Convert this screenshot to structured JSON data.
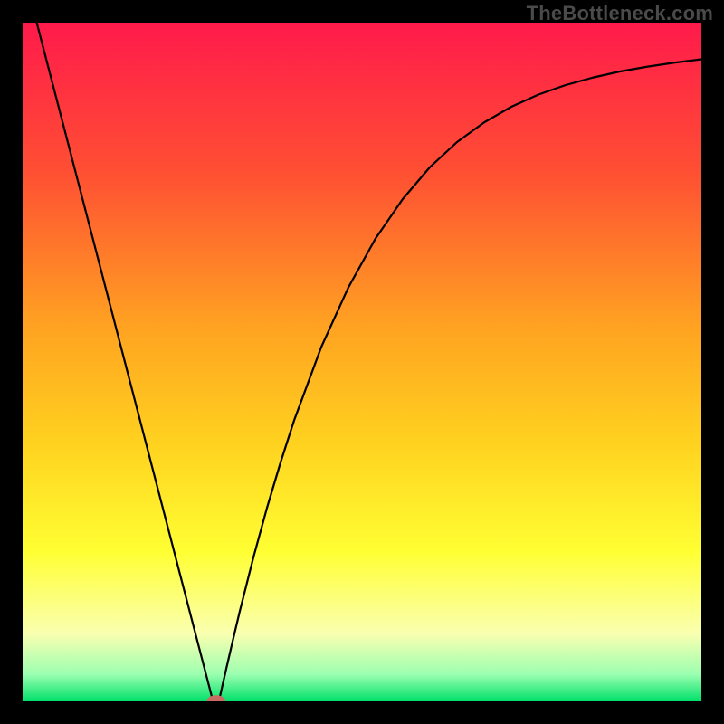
{
  "watermark": "TheBottleneck.com",
  "chart_data": {
    "type": "line",
    "title": "",
    "xlabel": "",
    "ylabel": "",
    "xlim": [
      0,
      100
    ],
    "ylim": [
      0,
      100
    ],
    "background_gradient": {
      "stops": [
        {
          "offset": 0.0,
          "color": "#ff1a4b"
        },
        {
          "offset": 0.22,
          "color": "#ff4f33"
        },
        {
          "offset": 0.45,
          "color": "#ffa321"
        },
        {
          "offset": 0.62,
          "color": "#ffd21f"
        },
        {
          "offset": 0.78,
          "color": "#ffff33"
        },
        {
          "offset": 0.9,
          "color": "#faffb0"
        },
        {
          "offset": 0.96,
          "color": "#9cffb0"
        },
        {
          "offset": 1.0,
          "color": "#00e06a"
        }
      ]
    },
    "series": [
      {
        "name": "bottleneck-curve",
        "x": [
          0,
          2,
          4,
          6,
          8,
          10,
          12,
          14,
          16,
          18,
          20,
          22,
          24,
          26,
          27,
          28,
          28.5,
          29,
          30,
          31,
          32,
          34,
          36,
          38,
          40,
          44,
          48,
          52,
          56,
          60,
          64,
          68,
          72,
          76,
          80,
          84,
          88,
          92,
          96,
          100
        ],
        "y": [
          108,
          100.3,
          92.6,
          84.9,
          77.2,
          69.5,
          61.8,
          54.1,
          46.4,
          38.7,
          31.0,
          23.3,
          15.6,
          7.9,
          4.05,
          0.2,
          0.0,
          0.4,
          4.8,
          9.1,
          13.3,
          21.2,
          28.5,
          35.2,
          41.4,
          52.2,
          61.0,
          68.2,
          74.0,
          78.7,
          82.4,
          85.3,
          87.6,
          89.4,
          90.8,
          91.9,
          92.8,
          93.5,
          94.1,
          94.6
        ]
      }
    ],
    "marker": {
      "name": "min-point",
      "x": 28.5,
      "y": 0.0,
      "rx": 1.4,
      "ry": 0.9,
      "color": "#c76b63"
    }
  }
}
